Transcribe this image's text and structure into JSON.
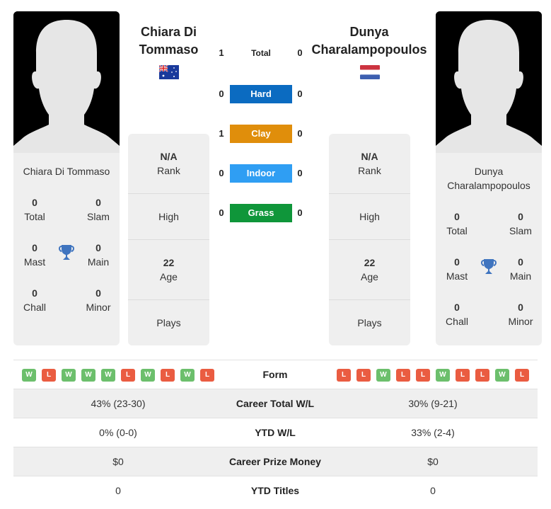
{
  "player1": {
    "name_header_line1": "Chiara Di",
    "name_header_line2": "Tommaso",
    "name_card": "Chiara Di Tommaso",
    "flag": "australia-flag",
    "titles": {
      "total": {
        "value": "0",
        "label": "Total"
      },
      "slam": {
        "value": "0",
        "label": "Slam"
      },
      "mast": {
        "value": "0",
        "label": "Mast"
      },
      "main": {
        "value": "0",
        "label": "Main"
      },
      "chall": {
        "value": "0",
        "label": "Chall"
      },
      "minor": {
        "value": "0",
        "label": "Minor"
      }
    },
    "info": {
      "rank_value": "N/A",
      "rank_label": "Rank",
      "high_label": "High",
      "age_value": "22",
      "age_label": "Age",
      "plays_label": "Plays"
    },
    "form": [
      "W",
      "L",
      "W",
      "W",
      "W",
      "L",
      "W",
      "L",
      "W",
      "L"
    ],
    "career_wl": "43% (23-30)",
    "ytd_wl": "0% (0-0)",
    "prize_money": "$0",
    "ytd_titles": "0"
  },
  "player2": {
    "name_header_line1": "Dunya",
    "name_header_line2": "Charalampopoulos",
    "name_card_line1": "Dunya",
    "name_card_line2": "Charalampopoulos",
    "flag": "netherlands-flag",
    "titles": {
      "total": {
        "value": "0",
        "label": "Total"
      },
      "slam": {
        "value": "0",
        "label": "Slam"
      },
      "mast": {
        "value": "0",
        "label": "Mast"
      },
      "main": {
        "value": "0",
        "label": "Main"
      },
      "chall": {
        "value": "0",
        "label": "Chall"
      },
      "minor": {
        "value": "0",
        "label": "Minor"
      }
    },
    "info": {
      "rank_value": "N/A",
      "rank_label": "Rank",
      "high_label": "High",
      "age_value": "22",
      "age_label": "Age",
      "plays_label": "Plays"
    },
    "form": [
      "L",
      "L",
      "W",
      "L",
      "L",
      "W",
      "L",
      "L",
      "W",
      "L"
    ],
    "career_wl": "30% (9-21)",
    "ytd_wl": "33% (2-4)",
    "prize_money": "$0",
    "ytd_titles": "0"
  },
  "h2h": [
    {
      "label": "Total",
      "p1": "1",
      "p2": "0",
      "color": ""
    },
    {
      "label": "Hard",
      "p1": "0",
      "p2": "0",
      "color": "#0b6bc1"
    },
    {
      "label": "Clay",
      "p1": "1",
      "p2": "0",
      "color": "#e08e0b"
    },
    {
      "label": "Indoor",
      "p1": "0",
      "p2": "0",
      "color": "#2f9ef3"
    },
    {
      "label": "Grass",
      "p1": "0",
      "p2": "0",
      "color": "#0f963a"
    }
  ],
  "stats_labels": {
    "form": "Form",
    "career_wl": "Career Total W/L",
    "ytd_wl": "YTD W/L",
    "prize_money": "Career Prize Money",
    "ytd_titles": "YTD Titles"
  },
  "colors": {
    "win": "#6cbf6c",
    "loss": "#ea5c41",
    "trophy": "#3f74bf"
  }
}
